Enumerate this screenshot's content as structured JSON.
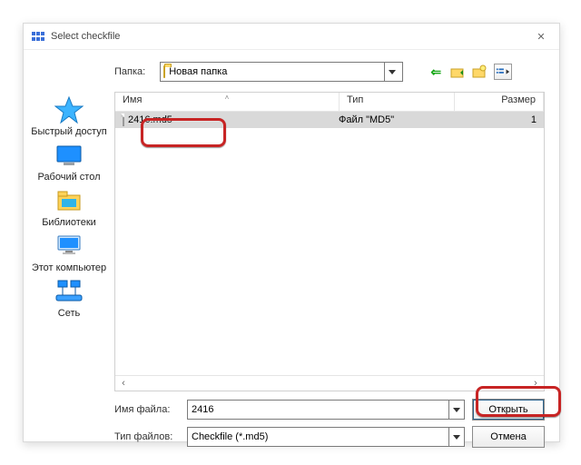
{
  "window": {
    "title": "Select checkfile",
    "close_glyph": "✕"
  },
  "folder_bar": {
    "label": "Папка:",
    "current": "Новая папка"
  },
  "nav_icons": {
    "back_glyph": "⇐",
    "up_title": "up",
    "new_title": "new",
    "views_title": "views"
  },
  "columns": {
    "name": "Имя",
    "type": "Тип",
    "size": "Размер",
    "sort_glyph": "˄"
  },
  "rows": [
    {
      "name": "2416.md5",
      "type": "Файл \"MD5\"",
      "size": "1"
    }
  ],
  "scroll": {
    "left_glyph": "‹",
    "right_glyph": "›"
  },
  "places": {
    "quick": "Быстрый доступ",
    "desktop": "Рабочий стол",
    "libraries": "Библиотеки",
    "computer": "Этот компьютер",
    "network": "Сеть"
  },
  "bottom": {
    "name_label": "Имя файла:",
    "name_value": "2416",
    "type_label": "Тип файлов:",
    "type_value": "Checkfile (*.md5)",
    "open": "Открыть",
    "cancel": "Отмена"
  }
}
